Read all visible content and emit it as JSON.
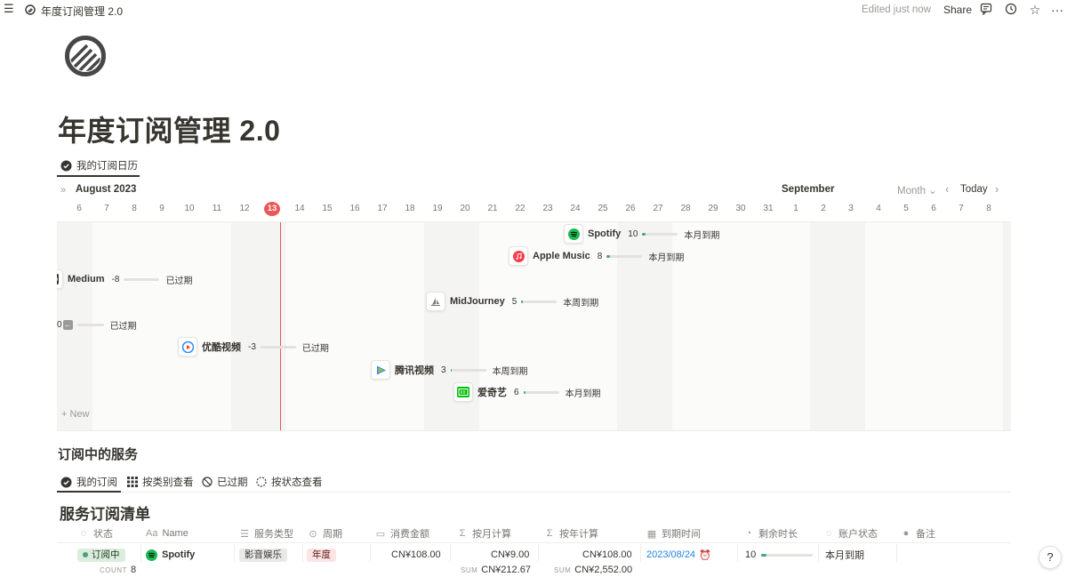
{
  "topbar": {
    "menu_icon": "menu-icon",
    "breadcrumb_title": "年度订阅管理 2.0",
    "edited": "Edited just now",
    "share": "Share",
    "icons": [
      "comment-icon",
      "history-icon",
      "star-icon",
      "more-icon"
    ]
  },
  "page": {
    "title": "年度订阅管理 2.0",
    "icon": "striped-circle-icon"
  },
  "calendar_view": {
    "tab_label": "我的订阅日历",
    "month_left": "August 2023",
    "month_right": "September",
    "view_mode": "Month",
    "today_label": "Today",
    "today_day": "13",
    "new_label": "New",
    "days": [
      "6",
      "7",
      "8",
      "9",
      "10",
      "11",
      "12",
      "13",
      "14",
      "15",
      "16",
      "17",
      "18",
      "19",
      "20",
      "21",
      "22",
      "23",
      "24",
      "25",
      "26",
      "27",
      "28",
      "29",
      "30",
      "31",
      "1",
      "2",
      "3",
      "4",
      "5",
      "6",
      "7",
      "8"
    ],
    "events": [
      {
        "name": "Spotify",
        "days": "10",
        "status": "本月到期",
        "icon": "spotify-icon",
        "color": "#1db954",
        "fill": 0.1
      },
      {
        "name": "Apple Music",
        "days": "8",
        "status": "本月到期",
        "icon": "apple-music-icon",
        "color": "#fa3c4c",
        "fill": 0.08
      },
      {
        "name": "Medium",
        "days": "-8",
        "status": "已过期",
        "icon": "medium-icon",
        "color": "#37352f",
        "fill": 0
      },
      {
        "name": "MidJourney",
        "days": "5",
        "status": "本周到期",
        "icon": "midjourney-icon",
        "color": "#37352f",
        "fill": 0.05
      },
      {
        "name": "0",
        "days": "",
        "status": "已过期",
        "icon": "arrow-left-icon",
        "color": "#787774",
        "fill": 0
      },
      {
        "name": "优酷视频",
        "days": "-3",
        "status": "已过期",
        "icon": "youku-icon",
        "color": "#1e90ff",
        "fill": 0
      },
      {
        "name": "腾讯视频",
        "days": "3",
        "status": "本周到期",
        "icon": "tencent-video-icon",
        "color": "#ff8c00",
        "fill": 0.03
      },
      {
        "name": "爱奇艺",
        "days": "6",
        "status": "本月到期",
        "icon": "iqiyi-icon",
        "color": "#00be06",
        "fill": 0.06
      }
    ]
  },
  "section": {
    "title": "订阅中的服务",
    "tabs": [
      {
        "label": "我的订阅",
        "icon": "check-circle-icon"
      },
      {
        "label": "按类别查看",
        "icon": "grid-icon"
      },
      {
        "label": "已过期",
        "icon": "block-icon"
      },
      {
        "label": "按状态查看",
        "icon": "dashed-circle-icon"
      }
    ]
  },
  "table": {
    "title": "服务订阅清单",
    "columns": [
      {
        "label": "状态",
        "icon": "status-icon"
      },
      {
        "label": "Name",
        "icon": "text-icon"
      },
      {
        "label": "服务类型",
        "icon": "list-icon"
      },
      {
        "label": "周期",
        "icon": "select-icon"
      },
      {
        "label": "消费金额",
        "icon": "money-icon"
      },
      {
        "label": "按月计算",
        "icon": "sigma-icon"
      },
      {
        "label": "按年计算",
        "icon": "sigma-icon"
      },
      {
        "label": "到期时间",
        "icon": "calendar-icon"
      },
      {
        "label": "剩余时长",
        "icon": "pie-icon"
      },
      {
        "label": "账户状态",
        "icon": "status-icon"
      },
      {
        "label": "备注",
        "icon": "comment-icon"
      }
    ],
    "rows": [
      {
        "status": "订阅中",
        "name": "Spotify",
        "type": "影音娱乐",
        "cycle": "年度",
        "amount": "CN¥108.00",
        "monthly": "CN¥9.00",
        "yearly": "CN¥108.00",
        "due": "2023/08/24",
        "remaining": "10",
        "remaining_fill": 0.1,
        "account": "本月到期",
        "note": ""
      }
    ],
    "footer": {
      "count_label": "COUNT",
      "count": "8",
      "sum_label": "SUM",
      "sum_monthly": "CN¥212.67",
      "sum_yearly": "CN¥2,552.00"
    }
  },
  "colors": {
    "accent_red": "#eb5757",
    "progress": "#4a9e8c",
    "status_green_bg": "#dbeddb",
    "type_tag_bg": "#e9e9e7",
    "cycle_tag_bg": "#fbe4e4",
    "link_blue": "#2383e2"
  }
}
